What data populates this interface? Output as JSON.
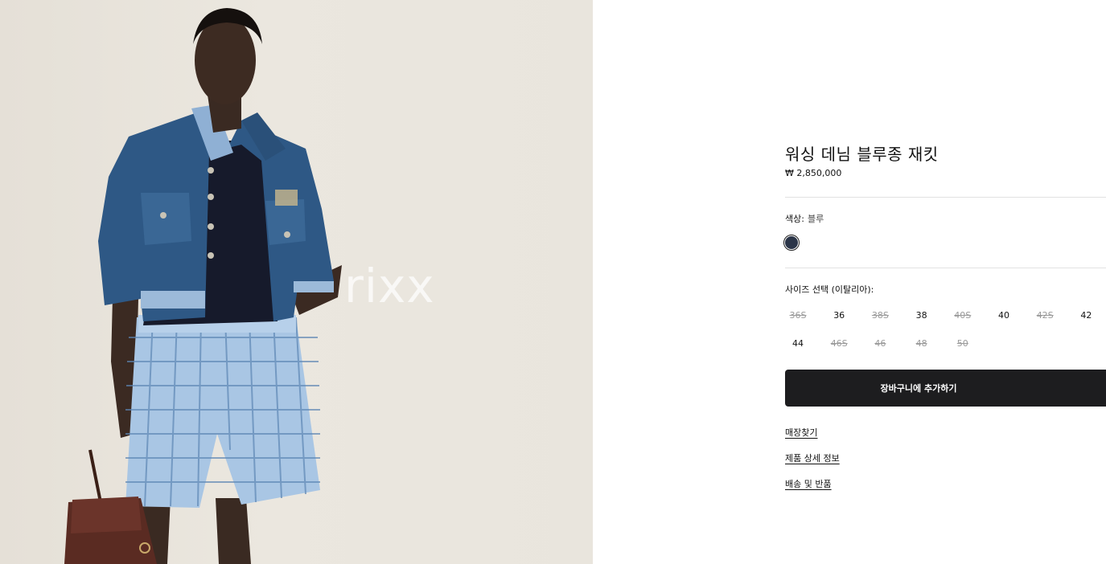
{
  "image": {
    "watermark": "rixx",
    "background_color": "#e8e3db"
  },
  "product": {
    "title": "워싱 데님 블루종 재킷",
    "price": "₩ 2,850,000"
  },
  "color": {
    "label": "색상:",
    "value": "블루",
    "swatch_color": "#2b3548"
  },
  "size": {
    "label": "사이즈 선택 (이탈리아):",
    "options": [
      {
        "label": "36S",
        "available": false
      },
      {
        "label": "36",
        "available": true
      },
      {
        "label": "38S",
        "available": false
      },
      {
        "label": "38",
        "available": true
      },
      {
        "label": "40S",
        "available": false
      },
      {
        "label": "40",
        "available": true
      },
      {
        "label": "42S",
        "available": false
      },
      {
        "label": "42",
        "available": true
      },
      {
        "label": "44",
        "available": true
      },
      {
        "label": "46S",
        "available": false
      },
      {
        "label": "46",
        "available": false
      },
      {
        "label": "48",
        "available": false
      },
      {
        "label": "50",
        "available": false
      }
    ]
  },
  "cart": {
    "button_label": "장바구니에 추가하기",
    "button_color": "#1d1d1f"
  },
  "links": {
    "store_finder": "매장찾기",
    "product_details": "제품 상세 정보",
    "shipping_returns": "배송 및 반품"
  }
}
